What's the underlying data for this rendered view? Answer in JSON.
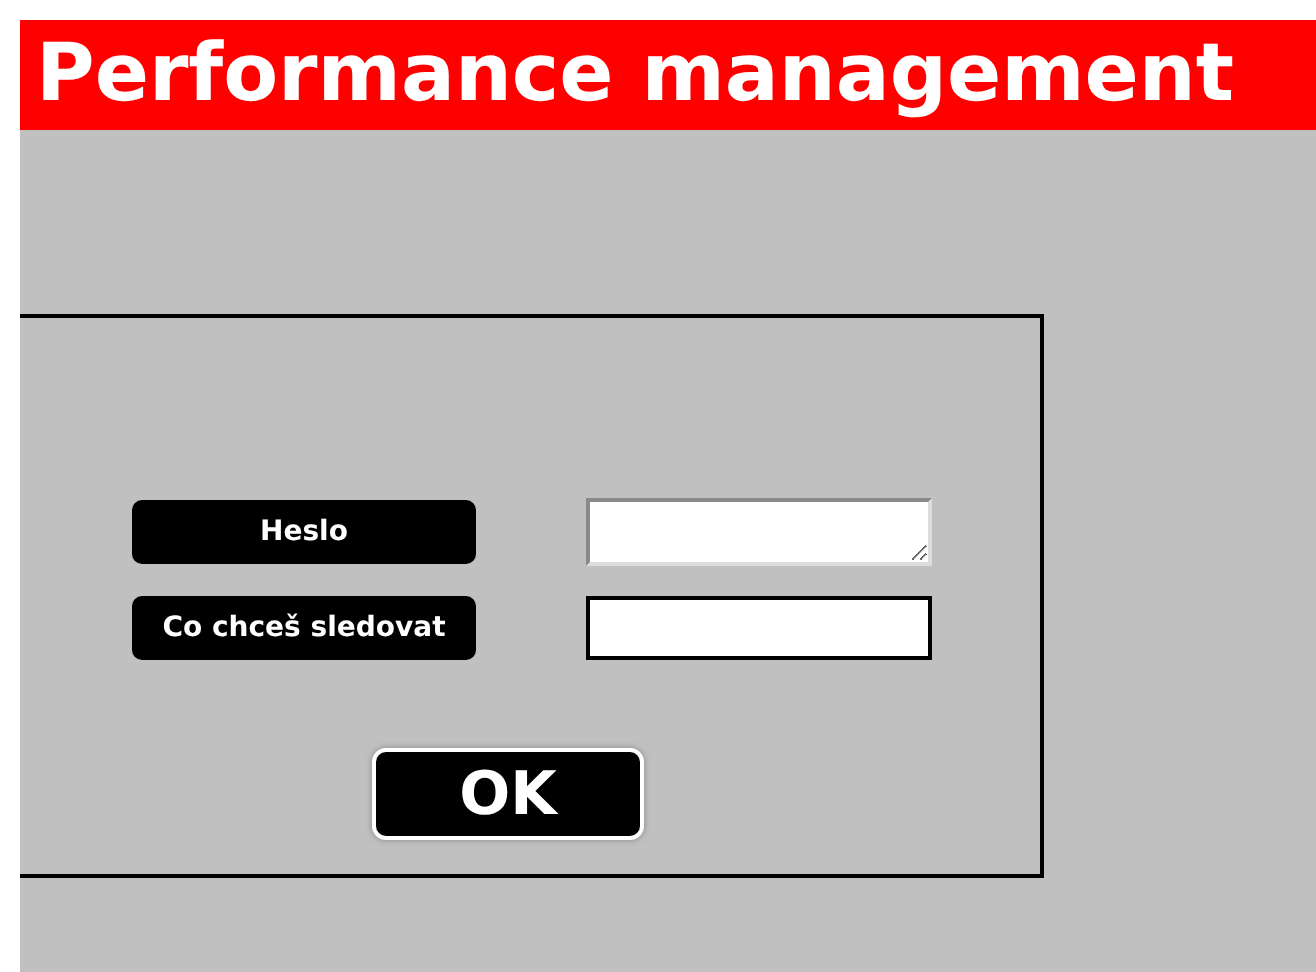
{
  "header": {
    "title": "Performance management"
  },
  "form": {
    "fields": [
      {
        "label": "Heslo",
        "kind": "textarea"
      },
      {
        "label": "Co chceš sledovat",
        "kind": "input"
      }
    ],
    "ok_button": "OK"
  }
}
